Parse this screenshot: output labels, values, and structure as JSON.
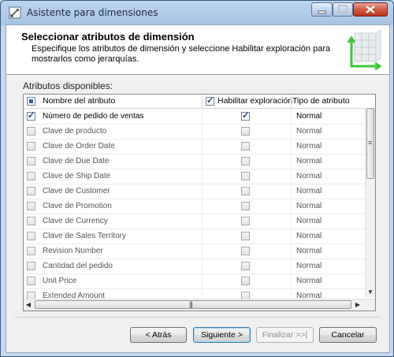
{
  "window": {
    "title": "Asistente para dimensiones"
  },
  "header": {
    "title": "Seleccionar atributos de dimensión",
    "description": "Especifique los atributos de dimensión y seleccione Habilitar exploración para mostrarlos como jerarquías."
  },
  "attributes": {
    "label": "Atributos disponibles:",
    "columns": {
      "name": "Nombre del atributo",
      "browse": "Habilitar exploración",
      "type": "Tipo de atributo"
    },
    "header_checkbox_state": "mixed",
    "browse_header_checked": true,
    "rows": [
      {
        "checked": true,
        "name": "Número de pedido de ventas",
        "browse": true,
        "type": "Normal"
      },
      {
        "checked": false,
        "name": "Clave de producto",
        "browse": false,
        "type": "Normal"
      },
      {
        "checked": false,
        "name": "Clave de Order Date",
        "browse": false,
        "type": "Normal"
      },
      {
        "checked": false,
        "name": "Clave de Due Date",
        "browse": false,
        "type": "Normal"
      },
      {
        "checked": false,
        "name": "Clave de Ship Date",
        "browse": false,
        "type": "Normal"
      },
      {
        "checked": false,
        "name": "Clave de Customer",
        "browse": false,
        "type": "Normal"
      },
      {
        "checked": false,
        "name": "Clave de Promotion",
        "browse": false,
        "type": "Normal"
      },
      {
        "checked": false,
        "name": "Clave de Currency",
        "browse": false,
        "type": "Normal"
      },
      {
        "checked": false,
        "name": "Clave de Sales Territory",
        "browse": false,
        "type": "Normal"
      },
      {
        "checked": false,
        "name": "Revision Number",
        "browse": false,
        "type": "Normal"
      },
      {
        "checked": false,
        "name": "Cantidad del pedido",
        "browse": false,
        "type": "Normal"
      },
      {
        "checked": false,
        "name": "Unit Price",
        "browse": false,
        "type": "Normal"
      },
      {
        "checked": false,
        "name": "Extended Amount",
        "browse": false,
        "type": "Normal"
      }
    ]
  },
  "buttons": {
    "back": "< Atrás",
    "next": "Siguiente >",
    "finish": "Finalizar >>|",
    "cancel": "Cancelar"
  },
  "icons": {
    "title": "wizard-icon",
    "header_art": "dimension-cube-icon"
  },
  "colors": {
    "accent_arrow": "#3cc83c"
  }
}
